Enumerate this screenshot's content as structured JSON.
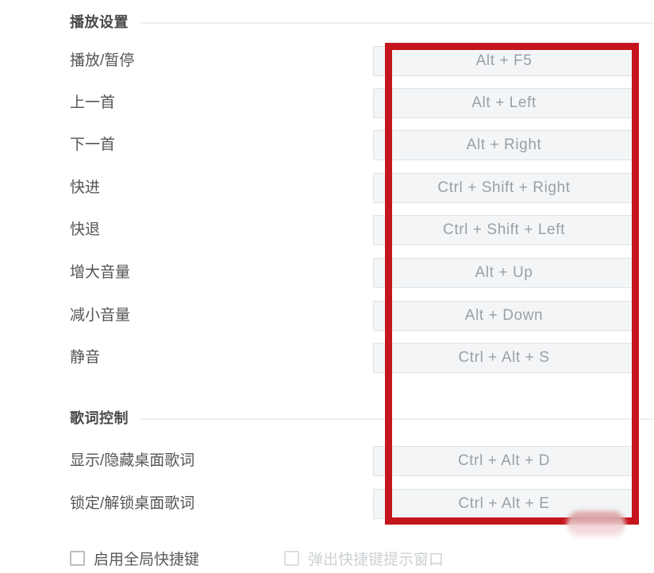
{
  "colors": {
    "annotation": "#c4161c",
    "label_text": "#555555",
    "input_text": "#9aa0a6",
    "input_bg": "#f3f5f7",
    "input_border": "#dfe3e6",
    "divider": "#f0f0f0",
    "disabled_text": "#cdd1d4"
  },
  "sections": [
    {
      "id": "playback",
      "title": "播放设置",
      "rows": [
        {
          "label": "播放/暂停",
          "shortcut": "Alt + F5"
        },
        {
          "label": "上一首",
          "shortcut": "Alt + Left"
        },
        {
          "label": "下一首",
          "shortcut": "Alt + Right"
        },
        {
          "label": "快进",
          "shortcut": "Ctrl + Shift + Right"
        },
        {
          "label": "快退",
          "shortcut": "Ctrl + Shift + Left"
        },
        {
          "label": "增大音量",
          "shortcut": "Alt + Up"
        },
        {
          "label": "减小音量",
          "shortcut": "Alt + Down"
        },
        {
          "label": "静音",
          "shortcut": "Ctrl + Alt + S"
        }
      ]
    },
    {
      "id": "lyrics",
      "title": "歌词控制",
      "rows": [
        {
          "label": "显示/隐藏桌面歌词",
          "shortcut": "Ctrl + Alt + D"
        },
        {
          "label": "锁定/解锁桌面歌词",
          "shortcut": "Ctrl + Alt + E"
        }
      ]
    }
  ],
  "footer": {
    "global_hotkey": {
      "label": "启用全局快捷键",
      "checked": false,
      "enabled": true
    },
    "popup_hint": {
      "label": "弹出快捷键提示窗口",
      "checked": false,
      "enabled": false
    }
  }
}
